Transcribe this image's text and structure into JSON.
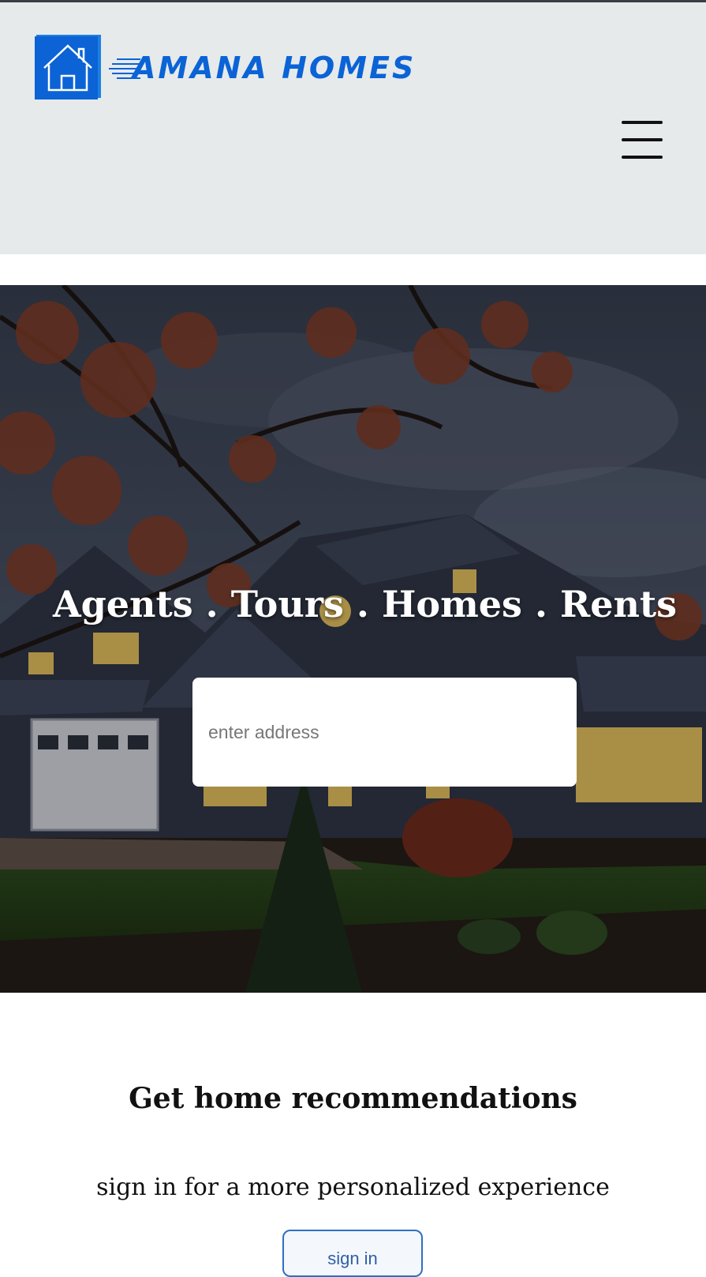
{
  "header": {
    "logo_text": "Amana Homes",
    "brand_color": "#0b63d6",
    "menu_icon": "hamburger-menu-icon"
  },
  "hero": {
    "tagline": "Agents . Tours . Homes . Rents",
    "search": {
      "placeholder": "enter address",
      "value": ""
    }
  },
  "recommendations": {
    "title": "Get home recommendations",
    "subtitle": "sign in for a more personalized experience",
    "signin_label": "sign in"
  }
}
